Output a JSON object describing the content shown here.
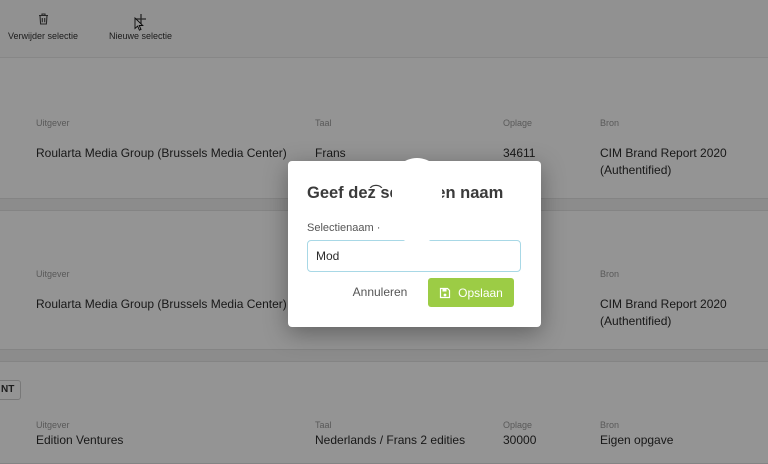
{
  "toolbar": {
    "delete_selection": "Verwijder selectie",
    "new_selection": "Nieuwe selectie"
  },
  "labels": {
    "publisher": "Uitgever",
    "language": "Taal",
    "circulation": "Oplage",
    "source": "Bron"
  },
  "rows": [
    {
      "publisher": "Roularta Media Group (Brussels Media Center)",
      "language": "Frans",
      "circulation": "34611",
      "source_line1": "CIM Brand Report 2020",
      "source_line2": "(Authentified)"
    },
    {
      "publisher": "Roularta Media Group (Brussels Media Center)",
      "language": "",
      "circulation": "",
      "source_line1": "CIM Brand Report 2020",
      "source_line2": "(Authentified)"
    },
    {
      "tag": "NT",
      "publisher": "Edition Ventures",
      "language": "Nederlands / Frans 2 edities",
      "circulation": "30000",
      "source_line1": "Eigen opgave"
    }
  ],
  "modal": {
    "title": "Geef dez͡ se tie ˓en naam",
    "field_label": "Selectienaam ·",
    "field_value": "Mod",
    "cancel_label": "Annuleren",
    "save_label": "Opslaan"
  },
  "colors": {
    "save_button": "#9ccc45",
    "input_border": "#a8d8e6",
    "overlay": "rgba(0,0,0,0.42)"
  },
  "icons": {
    "delete": "trash-icon",
    "new": "plus-icon",
    "save": "floppy-disk-icon"
  }
}
